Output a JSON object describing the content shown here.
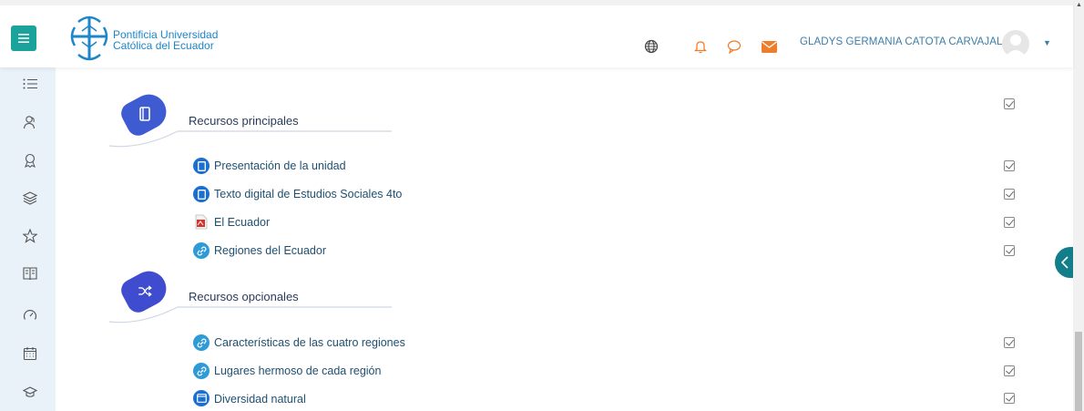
{
  "header": {
    "university_line1": "Pontificia Universidad",
    "university_line2": "Católica del Ecuador",
    "user_name": "GLADYS GERMANIA CATOTA CARVAJAL",
    "icons": [
      "menu-icon",
      "globe-icon",
      "bell-icon",
      "chat-icon",
      "mail-icon",
      "caret-down-icon"
    ]
  },
  "leftnav": {
    "icons": [
      "list-icon",
      "participants-icon",
      "badge-icon",
      "layers-icon",
      "star-icon",
      "book-icon",
      "dashboard-gauge-icon",
      "calendar-icon",
      "graduation-cap-icon"
    ]
  },
  "sections": [
    {
      "title": "Recursos principales",
      "icon": "book-bookmark-icon",
      "activities": [
        {
          "label": "Presentación de la unidad",
          "icon": "book-icon"
        },
        {
          "label": "Texto digital de Estudios Sociales 4to",
          "icon": "book-icon"
        },
        {
          "label": "El Ecuador",
          "icon": "pdf-icon"
        },
        {
          "label": "Regiones del Ecuador",
          "icon": "link-icon"
        }
      ]
    },
    {
      "title": "Recursos opcionales",
      "icon": "shuffle-icon",
      "activities": [
        {
          "label": "Características de las cuatro regiones",
          "icon": "link-icon"
        },
        {
          "label": "Lugares hermoso de cada región",
          "icon": "link-icon"
        },
        {
          "label": "Diversidad natural",
          "icon": "page-icon"
        }
      ]
    }
  ],
  "colors": {
    "accent_teal": "#1aa39a",
    "brand_blue": "#1c86c8",
    "section_icon_blue": "#3f5bd1",
    "link_icon": "#2e9bd6",
    "pdf_red": "#d6332e",
    "notification_orange": "#f07d2b"
  }
}
